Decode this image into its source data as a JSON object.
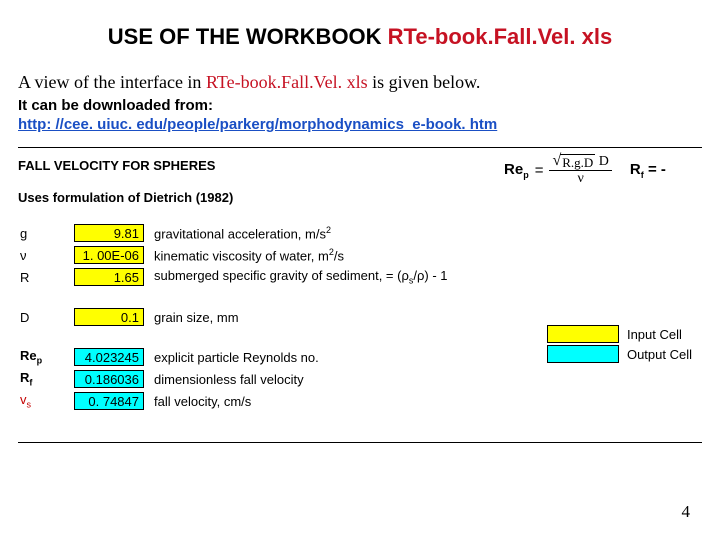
{
  "title": {
    "prefix": "USE OF THE WORKBOOK ",
    "filename": "RTe-book.Fall.Vel. xls"
  },
  "intro": {
    "pre": "A view of the interface in ",
    "file": "RTe-book.Fall.Vel. xls",
    "post": " is given below."
  },
  "download_label": "It can be downloaded from:",
  "download_url": "http: //cee. uiuc. edu/people/parkerg/morphodynamics_e-book. htm",
  "sheet": {
    "header1": "FALL VELOCITY FOR SPHERES",
    "header2": "Uses formulation of Dietrich (1982)",
    "rows_input": [
      {
        "sym": "g",
        "val": "9.81",
        "desc": "gravitational acceleration, m/s",
        "sup": "2"
      },
      {
        "sym": "ν",
        "val": "1. 00E-06",
        "desc": "kinematic viscosity of water, m",
        "sup": "2",
        "desc2": "/s"
      },
      {
        "sym": "R",
        "val": "1.65",
        "desc": "submerged specific gravity of sediment, = (ρ",
        "subs": "s",
        "desc2": "/ρ) - 1"
      }
    ],
    "row_D": {
      "sym": "D",
      "val": "0.1",
      "desc": "grain size, mm"
    },
    "rows_output": [
      {
        "sym": "Re",
        "sub": "p",
        "val": "4.023245",
        "desc": "explicit particle Reynolds no."
      },
      {
        "sym": "R",
        "sub": "f",
        "val": "0.186036",
        "desc": "dimensionless fall velocity"
      },
      {
        "sym": "v",
        "sub": "s",
        "val": "0. 74847",
        "desc": "fall velocity, cm/s"
      }
    ],
    "legend": {
      "input": "Input Cell",
      "output": "Output Cell"
    },
    "formula": {
      "rep": "Re",
      "rep_sub": "p",
      "eq": "=",
      "nu": "ν",
      "sqrt": "R.g.D",
      "trail_D": " D",
      "rf": "R",
      "rf_sub": "f",
      "rf_eq": "= -"
    }
  },
  "page_number": "4"
}
